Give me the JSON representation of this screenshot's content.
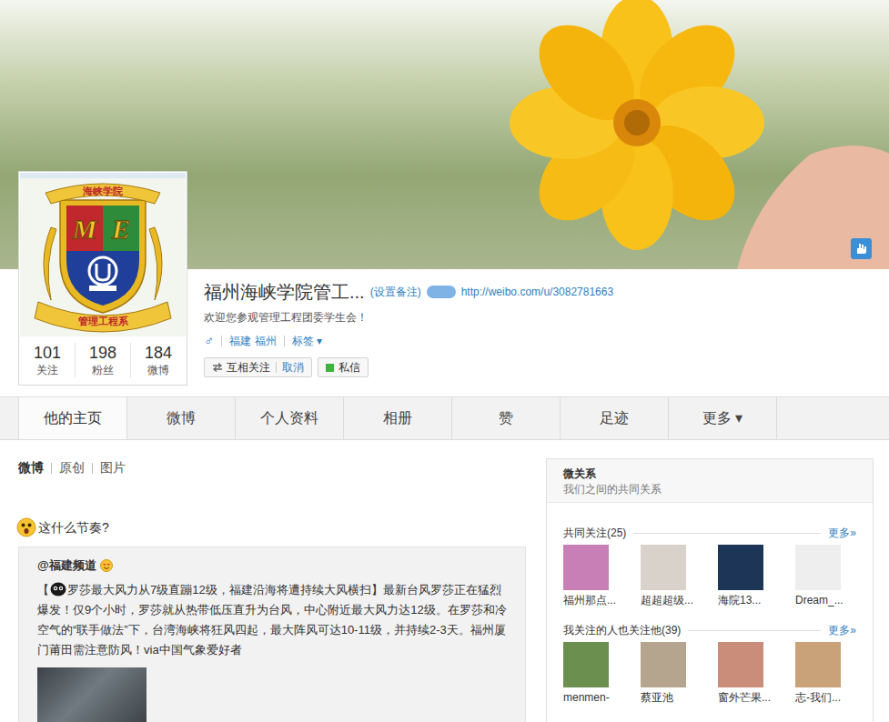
{
  "profile": {
    "name": "福州海峡学院管工...",
    "remark": "(设置备注)",
    "url": "http://weibo.com/u/3082781663",
    "intro": "欢迎您参观管理工程团委学生会！",
    "gender": "♂",
    "location": "福建 福州",
    "tag": "标签 ▾"
  },
  "logo": {
    "top": "海峡学院",
    "letters": [
      "M",
      "E"
    ],
    "bottom": "管理工程系"
  },
  "stats": [
    {
      "value": "101",
      "label": "关注"
    },
    {
      "value": "198",
      "label": "粉丝"
    },
    {
      "value": "184",
      "label": "微博"
    }
  ],
  "actions": {
    "follow": "互相关注",
    "cancel": "取消",
    "message": "私信"
  },
  "tabs": [
    {
      "label": "他的主页",
      "selected": true
    },
    {
      "label": "微博",
      "selected": false
    },
    {
      "label": "个人资料",
      "selected": false
    },
    {
      "label": "相册",
      "selected": false
    },
    {
      "label": "赞",
      "selected": false
    },
    {
      "label": "足迹",
      "selected": false
    },
    {
      "label": "更多 ▾",
      "selected": false
    }
  ],
  "feed_filters": [
    {
      "label": "微博",
      "selected": true
    },
    {
      "label": "原创",
      "selected": false
    },
    {
      "label": "图片",
      "selected": false
    }
  ],
  "post": {
    "text": "这什么节奏?",
    "repost": {
      "author": "@福建频道",
      "open_bracket": "【",
      "text": "罗莎最大风力从7级直蹦12级，福建沿海将遭持续大风横扫】最新台风罗莎正在猛烈爆发！仅9个小时，罗莎就从热带低压直升为台风，中心附近最大风力达12级。在罗莎和冷空气的“联手做法”下，台湾海峡将狂风四起，最大阵风可达10-11级，并持续2-3天。福州厦门莆田需注意防风！via中国气象爱好者"
    }
  },
  "sidebar": {
    "title": "微关系",
    "subtitle": "我们之间的共同关系",
    "sections": [
      {
        "title": "共同关注(25)",
        "more": "更多»",
        "users": [
          {
            "name": "福州那点...",
            "color": "#c77fb5"
          },
          {
            "name": "超超超级...",
            "color": "#d9d2ca"
          },
          {
            "name": "海院13...",
            "color": "#1d3557"
          },
          {
            "name": "Dream_...",
            "color": "#eeeeee"
          }
        ]
      },
      {
        "title": "我关注的人也关注他(39)",
        "more": "更多»",
        "users": [
          {
            "name": "menmen-",
            "color": "#6b8f4e"
          },
          {
            "name": "蔡亚池",
            "color": "#b5a58f"
          },
          {
            "name": "窗外芒果...",
            "color": "#c98d7a"
          },
          {
            "name": "志-我们...",
            "color": "#c9a27a"
          }
        ]
      }
    ]
  }
}
